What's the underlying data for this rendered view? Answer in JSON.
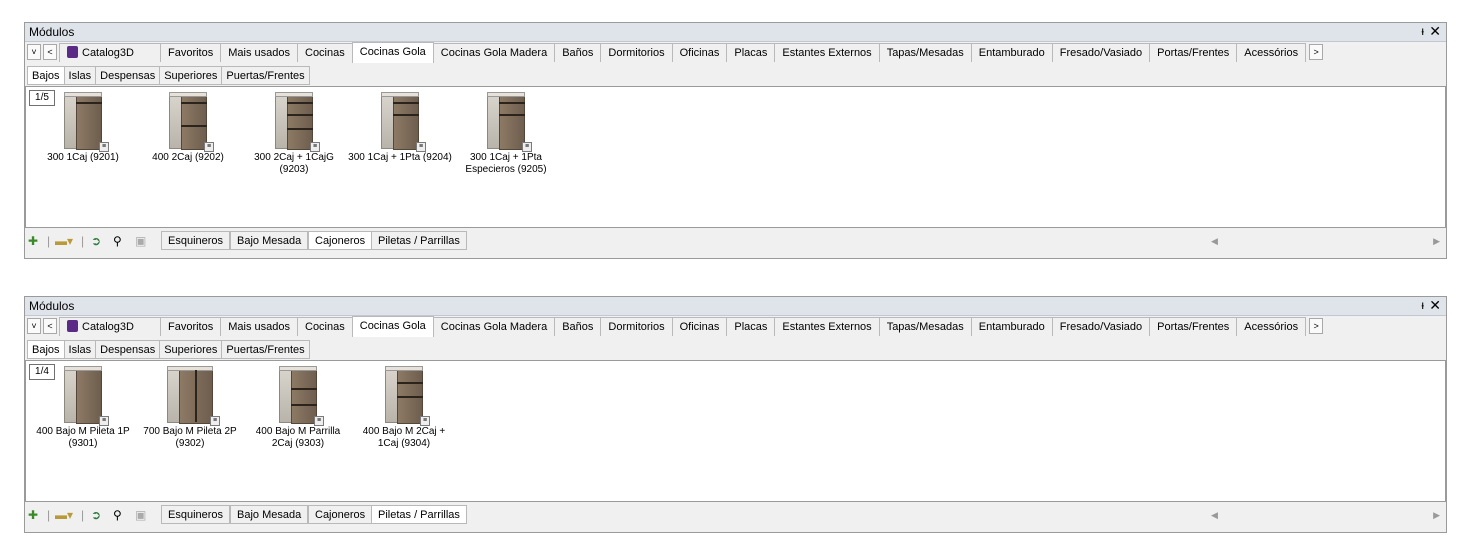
{
  "panels": [
    {
      "title": "Módulos",
      "catalog_label": "Catalog3D",
      "tabs": [
        "Favoritos",
        "Mais usados",
        "Cocinas",
        "Cocinas Gola",
        "Cocinas Gola Madera",
        "Baños",
        "Dormitorios",
        "Oficinas",
        "Placas",
        "Estantes Externos",
        "Tapas/Mesadas",
        "Entamburado",
        "Fresado/Vasiado",
        "Portas/Frentes",
        "Acessórios"
      ],
      "active_tab": "Cocinas Gola",
      "subtabs": [
        "Bajos",
        "Islas",
        "Despensas",
        "Superiores",
        "Puertas/Frentes"
      ],
      "active_subtab": "Bajos",
      "pager": "1/5",
      "items": [
        {
          "label": "300 1Caj (9201)"
        },
        {
          "label": "400 2Caj (9202)"
        },
        {
          "label": "300 2Caj + 1CajG (9203)"
        },
        {
          "label": "300 1Caj + 1Pta (9204)"
        },
        {
          "label": "300 1Caj + 1Pta Especieros (9205)"
        }
      ],
      "bottom_tabs": [
        "Esquineros",
        "Bajo Mesada",
        "Cajoneros",
        "Piletas / Parrillas"
      ],
      "active_bottom_tab": "Cajoneros"
    },
    {
      "title": "Módulos",
      "catalog_label": "Catalog3D",
      "tabs": [
        "Favoritos",
        "Mais usados",
        "Cocinas",
        "Cocinas Gola",
        "Cocinas Gola Madera",
        "Baños",
        "Dormitorios",
        "Oficinas",
        "Placas",
        "Estantes Externos",
        "Tapas/Mesadas",
        "Entamburado",
        "Fresado/Vasiado",
        "Portas/Frentes",
        "Acessórios"
      ],
      "active_tab": "Cocinas Gola",
      "subtabs": [
        "Bajos",
        "Islas",
        "Despensas",
        "Superiores",
        "Puertas/Frentes"
      ],
      "active_subtab": "Bajos",
      "pager": "1/4",
      "items": [
        {
          "label": "400 Bajo M Pileta 1P (9301)"
        },
        {
          "label": "700 Bajo M Pileta 2P (9302)"
        },
        {
          "label": "400 Bajo M Parrilla 2Caj (9303)"
        },
        {
          "label": "400 Bajo M 2Caj + 1Caj (9304)"
        }
      ],
      "bottom_tabs": [
        "Esquineros",
        "Bajo Mesada",
        "Cajoneros",
        "Piletas / Parrillas"
      ],
      "active_bottom_tab": "Piletas / Parrillas"
    }
  ],
  "icons": {
    "pin": "pin-icon",
    "close": "close-icon",
    "dropdown": "chevron-down-icon",
    "prev": "chevron-left-icon",
    "next": "chevron-right-icon",
    "catalog": "cube-icon"
  },
  "glyphs": {
    "pin": "ᵻ",
    "close": "✕",
    "down": "˅",
    "left": "<",
    "right": ">",
    "badge": "≡",
    "scroll_left": "◀",
    "scroll_right": "▶"
  }
}
